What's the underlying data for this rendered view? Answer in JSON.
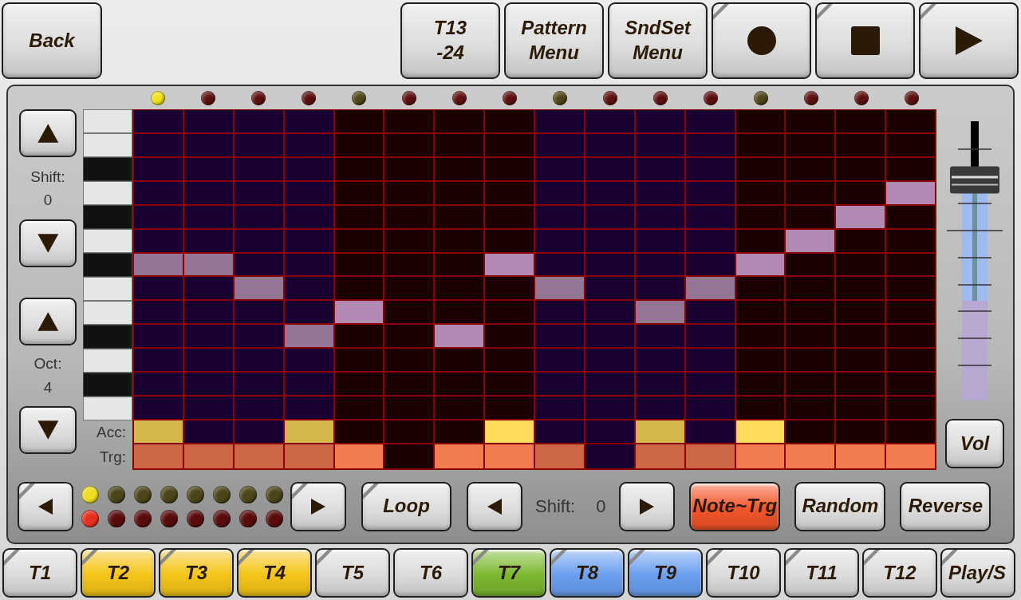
{
  "top_bar": [
    {
      "kind": "text",
      "lines": [
        "Back"
      ],
      "corner": false
    },
    {
      "kind": "text",
      "lines": [
        "T13",
        "-24"
      ],
      "corner": false
    },
    {
      "kind": "text",
      "lines": [
        "Pattern",
        "Menu"
      ],
      "corner": false
    },
    {
      "kind": "text",
      "lines": [
        "SndSet",
        "Menu"
      ],
      "corner": false
    },
    {
      "kind": "record",
      "corner": true
    },
    {
      "kind": "stop",
      "corner": true
    },
    {
      "kind": "play",
      "corner": true
    }
  ],
  "shift": {
    "label": "Shift:",
    "value": "0"
  },
  "octave": {
    "label": "Oct:",
    "value": "4"
  },
  "accent_label": "Acc:",
  "trigger_label": "Trg:",
  "steps": [
    {
      "color": "#f2e21a",
      "bright": false,
      "accent": true,
      "trigger": true
    },
    {
      "color": "#5e0e0e",
      "bright": false,
      "accent": false,
      "trigger": true
    },
    {
      "color": "#5e0e0e",
      "bright": false,
      "accent": false,
      "trigger": true
    },
    {
      "color": "#5e0e0e",
      "bright": false,
      "accent": true,
      "trigger": true
    },
    {
      "color": "#4f4516",
      "bright": true,
      "accent": false,
      "trigger": true
    },
    {
      "color": "#5e0e0e",
      "accent": false,
      "trigger": false
    },
    {
      "color": "#5e0e0e",
      "bright": true,
      "accent": false,
      "trigger": true
    },
    {
      "color": "#5e0e0e",
      "bright": true,
      "accent": true,
      "trigger": true
    },
    {
      "color": "#4f4516",
      "bright": false,
      "accent": false,
      "trigger": true
    },
    {
      "color": "#5e0e0e",
      "accent": false,
      "trigger": false
    },
    {
      "color": "#5e0e0e",
      "bright": false,
      "accent": true,
      "trigger": true
    },
    {
      "color": "#5e0e0e",
      "bright": false,
      "accent": false,
      "trigger": true
    },
    {
      "color": "#4f4516",
      "bright": true,
      "accent": true,
      "trigger": true
    },
    {
      "color": "#5e0e0e",
      "bright": true,
      "accent": false,
      "trigger": true
    },
    {
      "color": "#5e0e0e",
      "bright": true,
      "accent": false,
      "trigger": true
    },
    {
      "color": "#5e0e0e",
      "bright": true,
      "accent": false,
      "trigger": true
    }
  ],
  "rows": [
    {
      "kind": "white",
      "cells": [
        false,
        false,
        false,
        false,
        false,
        false,
        false,
        false,
        false,
        false,
        false,
        false,
        false,
        false,
        false,
        false
      ]
    },
    {
      "kind": "white",
      "cells": [
        false,
        false,
        false,
        false,
        false,
        false,
        false,
        false,
        false,
        false,
        false,
        false,
        false,
        false,
        false,
        false
      ]
    },
    {
      "kind": "black",
      "cells": [
        false,
        false,
        false,
        false,
        false,
        false,
        false,
        false,
        false,
        false,
        false,
        false,
        false,
        false,
        false,
        false
      ]
    },
    {
      "kind": "white",
      "cells": [
        false,
        false,
        false,
        false,
        false,
        false,
        false,
        false,
        false,
        false,
        false,
        false,
        false,
        false,
        false,
        true
      ]
    },
    {
      "kind": "black",
      "cells": [
        false,
        false,
        false,
        false,
        false,
        false,
        false,
        false,
        false,
        false,
        false,
        false,
        false,
        false,
        true,
        false
      ]
    },
    {
      "kind": "white",
      "cells": [
        false,
        false,
        false,
        false,
        false,
        false,
        false,
        false,
        false,
        false,
        false,
        false,
        false,
        true,
        false,
        false
      ]
    },
    {
      "kind": "black",
      "cells": [
        true,
        true,
        false,
        false,
        false,
        false,
        false,
        true,
        false,
        false,
        false,
        false,
        true,
        false,
        false,
        false
      ]
    },
    {
      "kind": "white",
      "cells": [
        false,
        false,
        true,
        false,
        false,
        false,
        false,
        false,
        true,
        false,
        false,
        true,
        false,
        false,
        false,
        false
      ]
    },
    {
      "kind": "white",
      "cells": [
        false,
        false,
        false,
        false,
        true,
        false,
        false,
        false,
        false,
        false,
        true,
        false,
        false,
        false,
        false,
        false
      ]
    },
    {
      "kind": "black",
      "cells": [
        false,
        false,
        false,
        true,
        false,
        false,
        true,
        false,
        false,
        false,
        false,
        false,
        false,
        false,
        false,
        false
      ]
    },
    {
      "kind": "white",
      "cells": [
        false,
        false,
        false,
        false,
        false,
        false,
        false,
        false,
        false,
        false,
        false,
        false,
        false,
        false,
        false,
        false
      ]
    },
    {
      "kind": "black",
      "cells": [
        false,
        false,
        false,
        false,
        false,
        false,
        false,
        false,
        false,
        false,
        false,
        false,
        false,
        false,
        false,
        false
      ]
    },
    {
      "kind": "white",
      "cells": [
        false,
        false,
        false,
        false,
        false,
        false,
        false,
        false,
        false,
        false,
        false,
        false,
        false,
        false,
        false,
        false
      ]
    }
  ],
  "volume": {
    "label": "Vol",
    "level": 0.79
  },
  "led_bank": [
    {
      "leds": [
        {
          "color": "#eedd22"
        },
        {
          "color": "#4a4418"
        },
        {
          "color": "#4a4418"
        },
        {
          "color": "#4a4418"
        },
        {
          "color": "#4a4418"
        },
        {
          "color": "#4a4418"
        },
        {
          "color": "#4a4418"
        },
        {
          "color": "#4a4418"
        }
      ]
    },
    {
      "leds": [
        {
          "color": "#e83020"
        },
        {
          "color": "#5a0c0c"
        },
        {
          "color": "#5a0c0c"
        },
        {
          "color": "#5a0c0c"
        },
        {
          "color": "#5a0c0c"
        },
        {
          "color": "#5a0c0c"
        },
        {
          "color": "#5a0c0c"
        },
        {
          "color": "#5a0c0c"
        }
      ]
    }
  ],
  "bottom_controls": {
    "loop": {
      "label": "Loop",
      "corner": true
    },
    "step_shift": {
      "label": "Shift:",
      "value": "0"
    },
    "modes": [
      {
        "label": "Note~Trg",
        "on": true
      },
      {
        "label": "Random",
        "on": false
      },
      {
        "label": "Reverse",
        "on": false
      }
    ]
  },
  "tracks": [
    {
      "label": "T1",
      "color": "#dcdcdc",
      "corner": true
    },
    {
      "label": "T2",
      "color": "#f5c518",
      "corner": true
    },
    {
      "label": "T3",
      "color": "#f5c518",
      "corner": true
    },
    {
      "label": "T4",
      "color": "#f5c518",
      "corner": true
    },
    {
      "label": "T5",
      "color": "#dcdcdc",
      "corner": true
    },
    {
      "label": "T6",
      "color": "#dcdcdc",
      "corner": false
    },
    {
      "label": "T7",
      "color": "#7cb82f",
      "corner": true
    },
    {
      "label": "T8",
      "color": "#6a9ff0",
      "corner": true
    },
    {
      "label": "T9",
      "color": "#6a9ff0",
      "corner": true
    },
    {
      "label": "T10",
      "color": "#dcdcdc",
      "corner": true
    },
    {
      "label": "T11",
      "color": "#dcdcdc",
      "corner": true
    },
    {
      "label": "T12",
      "color": "#dcdcdc",
      "corner": true
    },
    {
      "label": "Play/S",
      "color": "#dcdcdc",
      "corner": true
    }
  ]
}
